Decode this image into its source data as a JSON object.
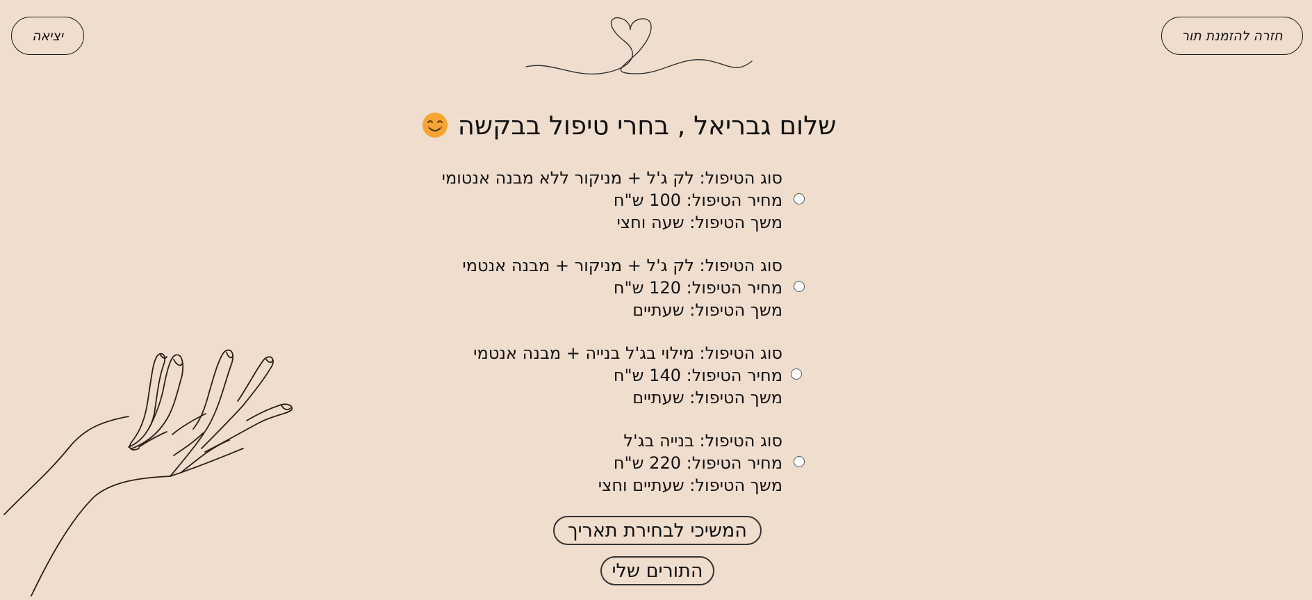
{
  "header": {
    "back_label": "חזרה להזמנת תור",
    "exit_label": "יציאה"
  },
  "title": "שלום גבריאל , בחרי טיפול בבקשה",
  "options": [
    {
      "type": "סוג הטיפול: לק ג'ל + מניקור ללא מבנה אנטומי",
      "price": "מחיר הטיפול: 100 ש\"ח",
      "duration": "משך הטיפול: שעה וחצי"
    },
    {
      "type": "סוג הטיפול: לק ג'ל + מניקור + מבנה אנטמי",
      "price": "מחיר הטיפול: 120 ש\"ח",
      "duration": "משך הטיפול: שעתיים"
    },
    {
      "type": "סוג הטיפול: מילוי בג'ל בנייה + מבנה אנטמי",
      "price": "מחיר הטיפול: 140 ש\"ח",
      "duration": "משך הטיפול: שעתיים"
    },
    {
      "type": "סוג הטיפול: בנייה בג'ל",
      "price": "מחיר הטיפול: 220 ש\"ח",
      "duration": "משך הטיפול: שעתיים וחצי"
    }
  ],
  "buttons": {
    "continue_label": "המשיכי לבחירת תאריך",
    "my_appointments_label": "התורים שלי"
  },
  "icons": {
    "title_emoji": "smiling-face-icon",
    "top_decoration": "heart-line-icon",
    "side_decoration": "hand-line-drawing"
  },
  "colors": {
    "background": "#efddcd",
    "text": "#111111",
    "emoji": "#f7a532"
  }
}
